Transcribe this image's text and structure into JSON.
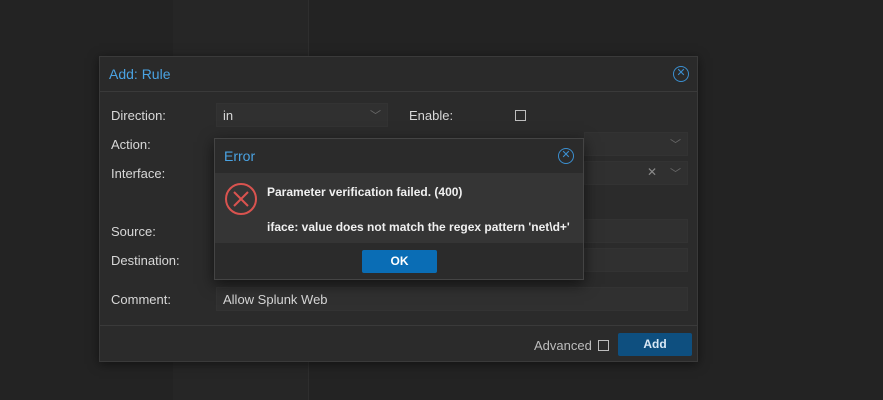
{
  "rule_dialog": {
    "title": "Add: Rule",
    "labels": {
      "direction": "Direction:",
      "enable": "Enable:",
      "action": "Action:",
      "interface": "Interface:",
      "source": "Source:",
      "destination": "Destination:",
      "comment": "Comment:"
    },
    "values": {
      "direction": "in",
      "comment": "Allow Splunk Web"
    },
    "enable_checked": false,
    "advanced_label": "Advanced",
    "advanced_checked": false,
    "add_label": "Add"
  },
  "error_dialog": {
    "title": "Error",
    "message": "Parameter verification failed. (400)",
    "detail": "iface: value does not match the regex pattern 'net\\d+'",
    "ok_label": "OK"
  },
  "colors": {
    "accent": "#4aa3e3",
    "primary_button": "#0a6db5",
    "error_icon": "#d9534f"
  },
  "icons": {
    "close": "close-icon",
    "error": "error-icon",
    "dropdown": "chevron-down-icon",
    "clear": "clear-icon"
  }
}
